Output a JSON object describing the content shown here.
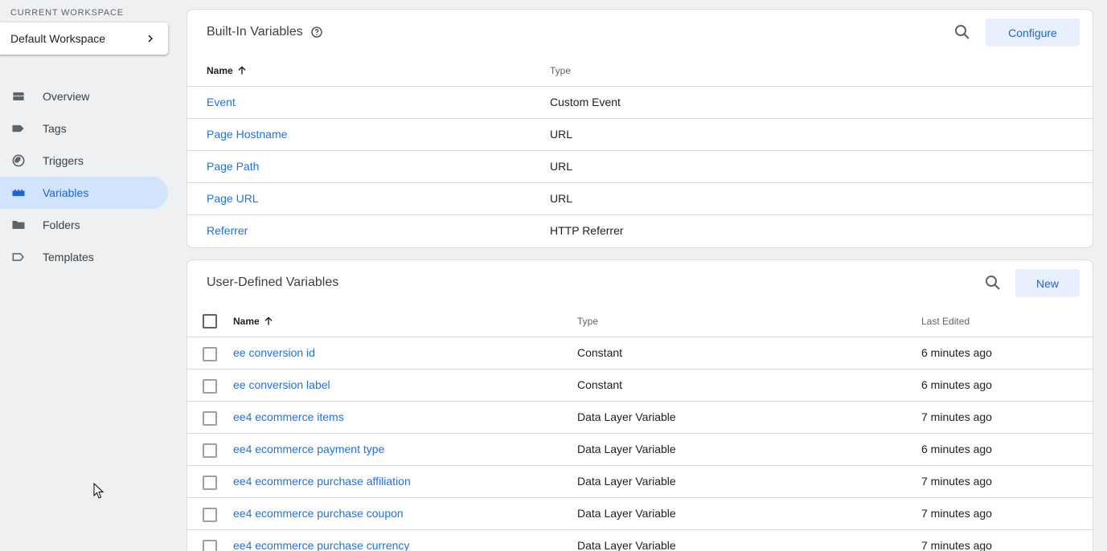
{
  "sidebar": {
    "workspace_label": "CURRENT WORKSPACE",
    "workspace_name": "Default Workspace",
    "items": [
      {
        "label": "Overview",
        "icon": "overview-icon"
      },
      {
        "label": "Tags",
        "icon": "tag-icon"
      },
      {
        "label": "Triggers",
        "icon": "trigger-icon"
      },
      {
        "label": "Variables",
        "icon": "variables-icon",
        "active": true
      },
      {
        "label": "Folders",
        "icon": "folder-icon"
      },
      {
        "label": "Templates",
        "icon": "template-icon"
      }
    ]
  },
  "builtin": {
    "title": "Built-In Variables",
    "configure_label": "Configure",
    "columns": {
      "name": "Name",
      "type": "Type"
    },
    "rows": [
      {
        "name": "Event",
        "type": "Custom Event"
      },
      {
        "name": "Page Hostname",
        "type": "URL"
      },
      {
        "name": "Page Path",
        "type": "URL"
      },
      {
        "name": "Page URL",
        "type": "URL"
      },
      {
        "name": "Referrer",
        "type": "HTTP Referrer"
      }
    ]
  },
  "userdefined": {
    "title": "User-Defined Variables",
    "new_label": "New",
    "columns": {
      "name": "Name",
      "type": "Type",
      "edited": "Last Edited"
    },
    "rows": [
      {
        "name": "ee conversion id",
        "type": "Constant",
        "edited": "6 minutes ago"
      },
      {
        "name": "ee conversion label",
        "type": "Constant",
        "edited": "6 minutes ago"
      },
      {
        "name": "ee4 ecommerce items",
        "type": "Data Layer Variable",
        "edited": "7 minutes ago"
      },
      {
        "name": "ee4 ecommerce payment type",
        "type": "Data Layer Variable",
        "edited": "6 minutes ago"
      },
      {
        "name": "ee4 ecommerce purchase affiliation",
        "type": "Data Layer Variable",
        "edited": "7 minutes ago"
      },
      {
        "name": "ee4 ecommerce purchase coupon",
        "type": "Data Layer Variable",
        "edited": "7 minutes ago"
      },
      {
        "name": "ee4 ecommerce purchase currency",
        "type": "Data Layer Variable",
        "edited": "7 minutes ago"
      }
    ]
  }
}
